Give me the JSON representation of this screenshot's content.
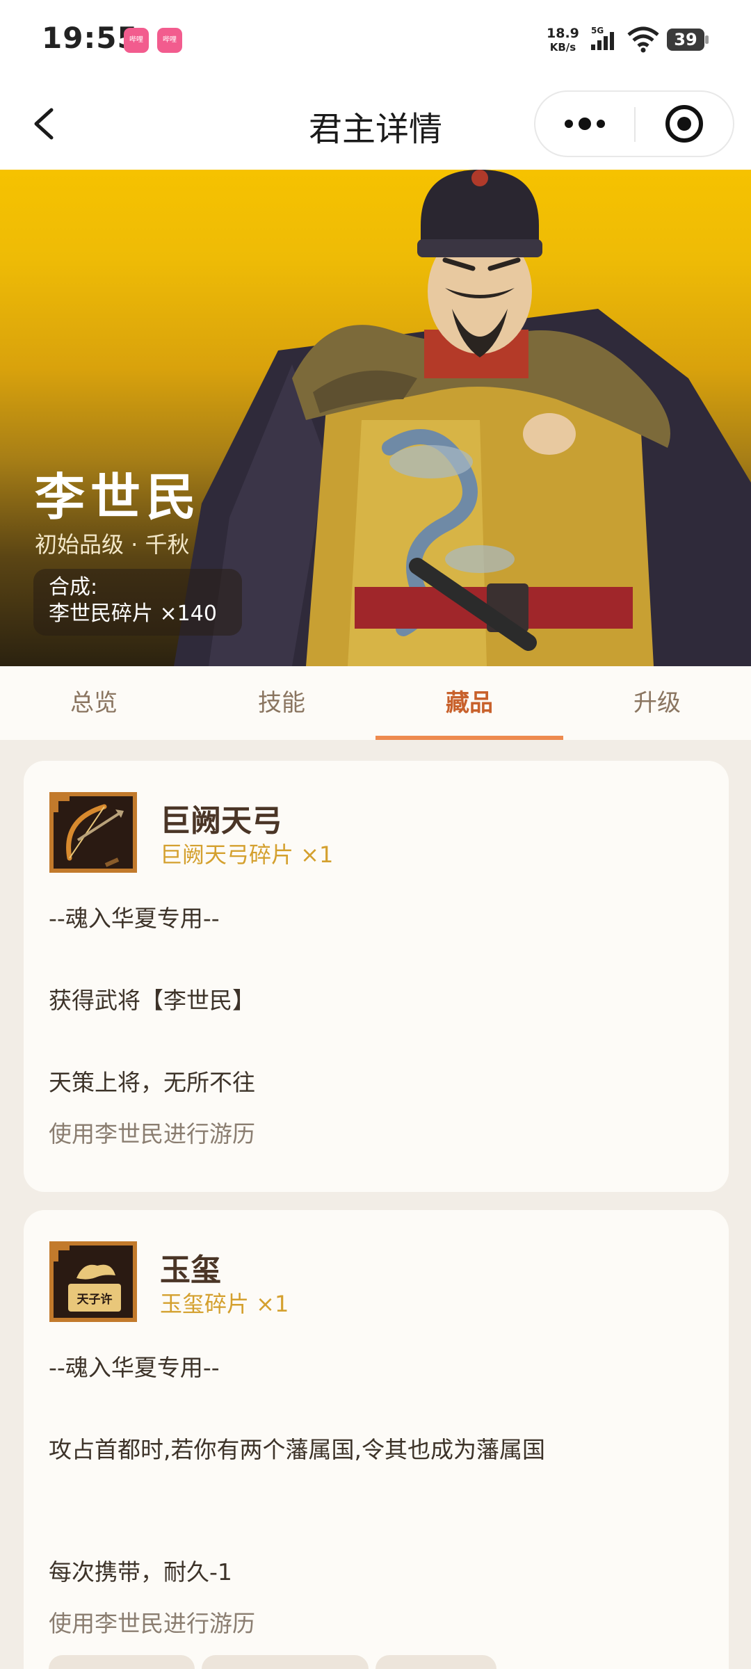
{
  "status_bar": {
    "time": "19:55",
    "app_badge": "哔哩",
    "net_speed_value": "18.9",
    "net_speed_unit": "KB/s",
    "network": "5G",
    "battery": "39"
  },
  "nav": {
    "title": "君主详情"
  },
  "hero": {
    "name": "李世民",
    "grade": "初始品级 · 千秋",
    "synth_label": "合成:",
    "synth_value": "李世民碎片 ×140"
  },
  "tabs": [
    {
      "label": "总览",
      "active": false
    },
    {
      "label": "技能",
      "active": false
    },
    {
      "label": "藏品",
      "active": true
    },
    {
      "label": "升级",
      "active": false
    }
  ],
  "items": [
    {
      "name": "巨阙天弓",
      "fragment": "巨阙天弓碎片 ×1",
      "icon": "bow-icon",
      "lines": [
        "--魂入华夏专用--",
        "获得武将【李世民】",
        "天策上将，无所不往"
      ],
      "usage": "使用李世民进行游历"
    },
    {
      "name": "玉玺",
      "fragment": "玉玺碎片 ×1",
      "icon": "jade-seal-icon",
      "icon_text": "天子许",
      "lines": [
        "--魂入华夏专用--",
        "攻占首都时,若你有两个藩属国,令其也成为藩属国",
        "每次携带，耐久-1"
      ],
      "usage": "使用李世民进行游历"
    }
  ],
  "colors": {
    "accent": "#ee8a4f",
    "active_tab": "#c8612c",
    "fragment": "#d4a02e",
    "hero_top": "#f6c200",
    "card_bg": "#fdfbf7",
    "page_bg": "#f2ede6"
  }
}
